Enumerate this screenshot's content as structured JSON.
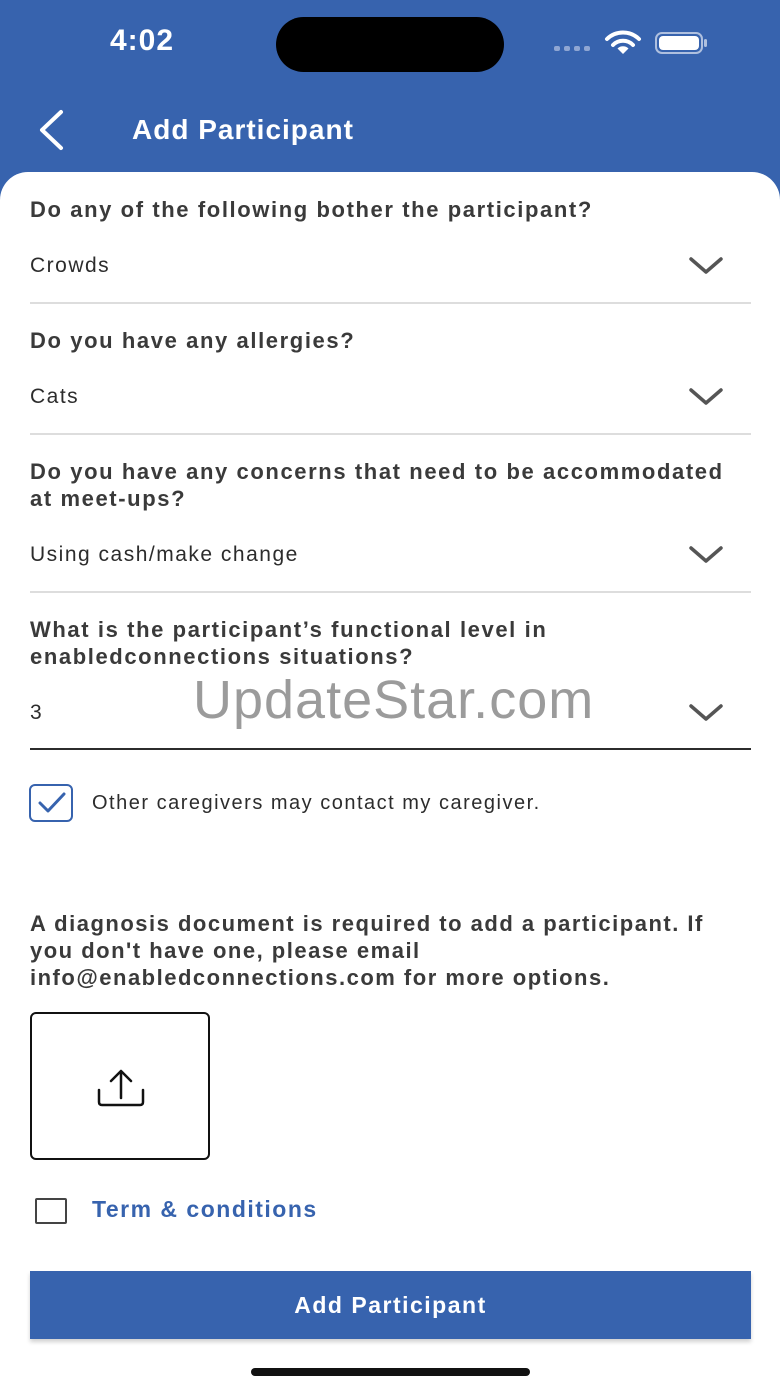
{
  "status_bar": {
    "time": "4:02"
  },
  "header": {
    "title": "Add Participant"
  },
  "watermark": "UpdateStar.com",
  "form": {
    "questions": [
      {
        "label": "Do any of the following bother the participant?",
        "value": "Crowds"
      },
      {
        "label": "Do you have any allergies?",
        "value": "Cats"
      },
      {
        "label": "Do you have any concerns that need to be accommodated at meet-ups?",
        "value": "Using cash/make change"
      },
      {
        "label": "What is the participant’s functional level in enabledconnections situations?",
        "value": "3"
      }
    ],
    "contact_checkbox": {
      "label": "Other caregivers may contact my caregiver.",
      "checked": true
    },
    "diagnosis_text": "A diagnosis document is required to add a participant. If you don't have one, please email info@enabledconnections.com for more options.",
    "terms": {
      "label": "Term & conditions",
      "checked": false
    },
    "submit_label": "Add Participant"
  },
  "colors": {
    "brand": "#3763ae",
    "text": "#3a3a3a",
    "divider": "#dddddd"
  }
}
